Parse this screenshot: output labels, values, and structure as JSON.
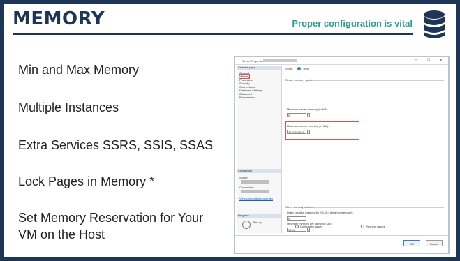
{
  "slide": {
    "title": "MEMORY",
    "subtitle": "Proper configuration is vital",
    "icon": "database-icon",
    "colors": {
      "dark_navy": "#1f3556",
      "teal": "#2f9c8f",
      "highlight_red": "#d9534f"
    }
  },
  "bullets": [
    {
      "text": "Min and Max Memory"
    },
    {
      "text": "Multiple Instances"
    },
    {
      "text": "Extra Services SSRS, SSIS, SSAS"
    },
    {
      "text": "Lock Pages in Memory *"
    },
    {
      "text": "Set Memory Reservation for Your VM on the Host"
    }
  ],
  "dialog": {
    "title": "Server Properties -",
    "select_page_label": "Select a page",
    "pages": [
      "General",
      "Memory",
      "Processors",
      "Security",
      "Connections",
      "Database Settings",
      "Advanced",
      "Permissions"
    ],
    "selected_page": "Memory",
    "toolbar": {
      "script": "Script",
      "help": "Help"
    },
    "server_memory_group": "Server memory options",
    "min_label": "Minimum server memory (in MB):",
    "min_value": "0",
    "max_label": "Maximum server memory (in MB):",
    "max_value": "2147483647",
    "other_group": "Other memory options",
    "index_label": "Index creation memory (in KB, 0 = dynamic memory):",
    "index_value": "0",
    "query_label": "Minimum memory per query (in KB):",
    "query_value": "1024",
    "connection_label": "Connection",
    "server_label": "Server:",
    "conn_label": "Connection:",
    "view_conn_link": "View connection properties",
    "progress_label": "Progress",
    "ready_label": "Ready",
    "configured_values": "Configured values",
    "running_values": "Running values",
    "ok": "OK",
    "cancel": "Cancel",
    "window_controls": [
      "–",
      "□",
      "✕"
    ]
  }
}
